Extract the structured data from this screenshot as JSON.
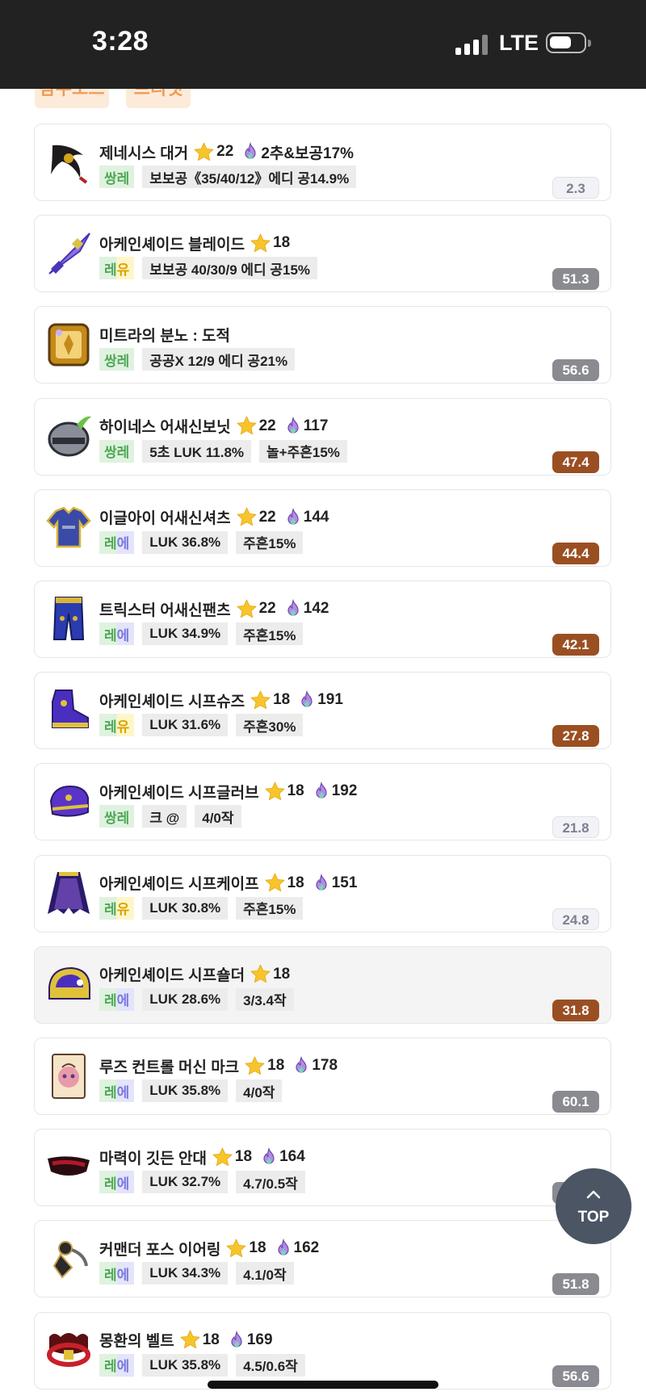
{
  "status_bar": {
    "time": "3:28",
    "network": "LTE"
  },
  "tabs_partial": [
    "잠수모드",
    "프리셋"
  ],
  "items": [
    {
      "name": "제네시스 대거",
      "stars": "22",
      "flame": "2추&보공17%",
      "pot": "쌍레",
      "pot_a": "쌍",
      "pot_b": "레",
      "pot_style": "ssr",
      "options": [
        "보보공《35/40/12》에디 공14.9%"
      ],
      "score": "2.3",
      "score_style": "light",
      "icon": "dagger-icon",
      "colors": {
        "a": "#1e1b1d",
        "b": "#d4a21b",
        "c": "#b2242a"
      }
    },
    {
      "name": "아케인셰이드 블레이드",
      "stars": "18",
      "flame": "",
      "pot": "레유",
      "pot_a": "레",
      "pot_b": "유",
      "pot_style": "lu",
      "options": [
        "보보공 40/30/9 에디 공15%"
      ],
      "score": "51.3",
      "score_style": "grey",
      "icon": "blade-icon",
      "colors": {
        "a": "#4a36b8",
        "b": "#d8c24a",
        "c": "#8f6fe0"
      }
    },
    {
      "name": "미트라의 분노 : 도적",
      "stars": "",
      "flame": "",
      "pot": "쌍레",
      "pot_a": "쌍",
      "pot_b": "레",
      "pot_style": "ssr",
      "options": [
        "공공X 12/9 에디 공21%"
      ],
      "score": "56.6",
      "score_style": "grey",
      "icon": "emblem-icon",
      "colors": {
        "a": "#c48a1a",
        "b": "#f3d27a",
        "c": "#5a3c10"
      }
    },
    {
      "name": "하이네스 어새신보닛",
      "stars": "22",
      "flame": "117",
      "pot": "쌍레",
      "pot_a": "쌍",
      "pot_b": "레",
      "pot_style": "ssr",
      "options": [
        "5초 LUK 11.8%",
        "놀+주흔15%"
      ],
      "score": "47.4",
      "score_style": "brown",
      "icon": "helmet-icon",
      "colors": {
        "a": "#8a8e98",
        "b": "#2c2f36",
        "c": "#6cc04a"
      }
    },
    {
      "name": "이글아이 어새신셔츠",
      "stars": "22",
      "flame": "144",
      "pot": "레에",
      "pot_a": "레",
      "pot_b": "에",
      "pot_style": "le",
      "options": [
        "LUK 36.8%",
        "주흔15%"
      ],
      "score": "44.4",
      "score_style": "brown",
      "icon": "shirt-icon",
      "colors": {
        "a": "#3a4aa8",
        "b": "#d8b43a",
        "c": "#9aa6c8"
      }
    },
    {
      "name": "트릭스터 어새신팬츠",
      "stars": "22",
      "flame": "142",
      "pot": "레에",
      "pot_a": "레",
      "pot_b": "에",
      "pot_style": "le",
      "options": [
        "LUK 34.9%",
        "주흔15%"
      ],
      "score": "42.1",
      "score_style": "brown",
      "icon": "pants-icon",
      "colors": {
        "a": "#2a3cb0",
        "b": "#d8b43a",
        "c": "#141c5a"
      }
    },
    {
      "name": "아케인셰이드 시프슈즈",
      "stars": "18",
      "flame": "191",
      "pot": "레유",
      "pot_a": "레",
      "pot_b": "유",
      "pot_style": "lu",
      "options": [
        "LUK 31.6%",
        "주흔30%"
      ],
      "score": "27.8",
      "score_style": "brown",
      "icon": "shoes-icon",
      "colors": {
        "a": "#4a2ec0",
        "b": "#e0c23a",
        "c": "#2a1a6a"
      }
    },
    {
      "name": "아케인셰이드 시프글러브",
      "stars": "18",
      "flame": "192",
      "pot": "쌍레",
      "pot_a": "쌍",
      "pot_b": "레",
      "pot_style": "ssr",
      "options": [
        "크 @",
        "4/0작"
      ],
      "score": "21.8",
      "score_style": "light",
      "icon": "gloves-icon",
      "colors": {
        "a": "#5a34c8",
        "b": "#e0c23a",
        "c": "#2a1a6a"
      }
    },
    {
      "name": "아케인셰이드 시프케이프",
      "stars": "18",
      "flame": "151",
      "pot": "레유",
      "pot_a": "레",
      "pot_b": "유",
      "pot_style": "lu",
      "options": [
        "LUK 30.8%",
        "주흔15%"
      ],
      "score": "24.8",
      "score_style": "light",
      "icon": "cape-icon",
      "colors": {
        "a": "#2a1a6a",
        "b": "#9a6ae8",
        "c": "#e0c23a"
      }
    },
    {
      "name": "아케인셰이드 시프숄더",
      "stars": "18",
      "flame": "",
      "pot": "레에",
      "pot_a": "레",
      "pot_b": "에",
      "pot_style": "le",
      "options": [
        "LUK 28.6%",
        "3/3.4작"
      ],
      "score": "31.8",
      "score_style": "brown",
      "selected": true,
      "icon": "shoulder-icon",
      "colors": {
        "a": "#4a2ec0",
        "b": "#e0c23a",
        "c": "#2a1a6a"
      }
    },
    {
      "name": "루즈 컨트롤 머신 마크",
      "stars": "18",
      "flame": "178",
      "pot": "레에",
      "pot_a": "레",
      "pot_b": "에",
      "pot_style": "le",
      "options": [
        "LUK 35.8%",
        "4/0작"
      ],
      "score": "60.1",
      "score_style": "grey",
      "icon": "badge-icon",
      "colors": {
        "a": "#f6e4c8",
        "b": "#e89aa8",
        "c": "#5a4030"
      }
    },
    {
      "name": "마력이 깃든 안대",
      "stars": "18",
      "flame": "164",
      "pot": "레에",
      "pot_a": "레",
      "pot_b": "에",
      "pot_style": "le",
      "options": [
        "LUK 32.7%",
        "4.7/0.5작"
      ],
      "score": "57.7",
      "score_style": "grey",
      "icon": "eyepatch-icon",
      "colors": {
        "a": "#2a0c10",
        "b": "#b0182a",
        "c": "#5a1a1a"
      }
    },
    {
      "name": "커맨더 포스 이어링",
      "stars": "18",
      "flame": "162",
      "pot": "레에",
      "pot_a": "레",
      "pot_b": "에",
      "pot_style": "le",
      "options": [
        "LUK 34.3%",
        "4.1/0작"
      ],
      "score": "51.8",
      "score_style": "grey",
      "icon": "earring-icon",
      "colors": {
        "a": "#2a2a2a",
        "b": "#c8a04a",
        "c": "#6a6a6a"
      }
    },
    {
      "name": "몽환의 벨트",
      "stars": "18",
      "flame": "169",
      "pot": "레에",
      "pot_a": "레",
      "pot_b": "에",
      "pot_style": "le",
      "options": [
        "LUK 35.8%",
        "4.5/0.6작"
      ],
      "score": "56.6",
      "score_style": "grey",
      "icon": "belt-icon",
      "colors": {
        "a": "#c8202a",
        "b": "#e0c23a",
        "c": "#5a1010"
      }
    }
  ],
  "top_button": {
    "label": "TOP"
  }
}
